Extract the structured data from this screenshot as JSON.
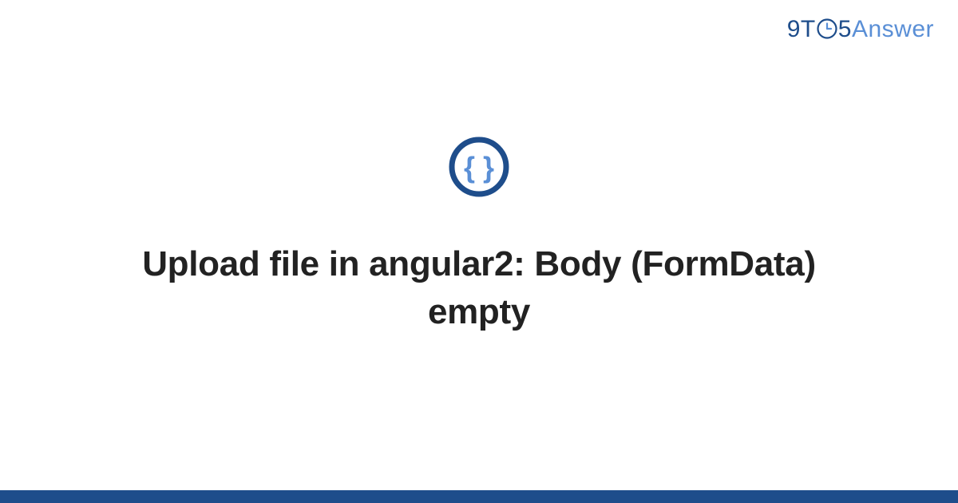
{
  "logo": {
    "part1": "9T",
    "part2": "5",
    "part3": "Answer"
  },
  "title": "Upload file in angular2: Body (FormData) empty",
  "colors": {
    "brand_dark": "#1e4d8b",
    "brand_light": "#5a8fd6",
    "text": "#222222"
  },
  "badge": {
    "name": "code-braces-icon"
  }
}
